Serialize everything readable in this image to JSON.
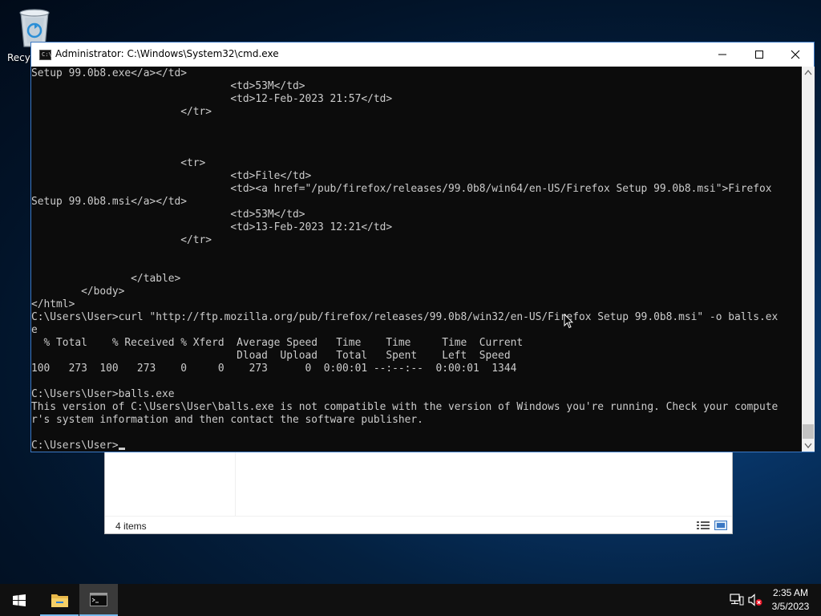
{
  "desktop": {
    "recycle_bin_label": "Recycle Bin"
  },
  "explorer": {
    "status_count": "4 items"
  },
  "cmd": {
    "title": "Administrator: C:\\Windows\\System32\\cmd.exe",
    "icon_text": "C:\\_",
    "lines": [
      "Setup 99.0b8.exe</a></td>",
      "                                <td>53M</td>",
      "                                <td>12-Feb-2023 21:57</td>",
      "                        </tr>",
      "",
      "",
      "",
      "                        <tr>",
      "                                <td>File</td>",
      "                                <td><a href=\"/pub/firefox/releases/99.0b8/win64/en-US/Firefox Setup 99.0b8.msi\">Firefox",
      "Setup 99.0b8.msi</a></td>",
      "                                <td>53M</td>",
      "                                <td>13-Feb-2023 12:21</td>",
      "                        </tr>",
      "",
      "",
      "                </table>",
      "        </body>",
      "</html>",
      "C:\\Users\\User>curl \"http://ftp.mozilla.org/pub/firefox/releases/99.0b8/win32/en-US/Firefox Setup 99.0b8.msi\" -o balls.ex",
      "e",
      "  % Total    % Received % Xferd  Average Speed   Time    Time     Time  Current",
      "                                 Dload  Upload   Total   Spent    Left  Speed",
      "100   273  100   273    0     0    273      0  0:00:01 --:--:--  0:00:01  1344",
      "",
      "C:\\Users\\User>balls.exe",
      "This version of C:\\Users\\User\\balls.exe is not compatible with the version of Windows you're running. Check your compute",
      "r's system information and then contact the software publisher.",
      "",
      "C:\\Users\\User>"
    ]
  },
  "taskbar": {
    "time": "2:35 AM",
    "date": "3/5/2023",
    "pinned": [
      "start",
      "file-explorer",
      "command-prompt"
    ]
  },
  "colors": {
    "console_bg": "#0c0c0c",
    "console_fg": "#cccccc",
    "taskbar_bg": "#101010",
    "accent": "#76b9ed"
  }
}
